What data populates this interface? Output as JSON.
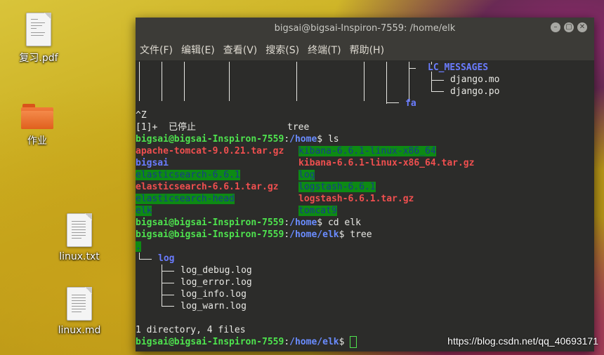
{
  "desktop": {
    "icons": [
      {
        "label": "复习.pdf",
        "icon": "pdf-file-icon"
      },
      {
        "label": "作业",
        "icon": "folder-icon"
      },
      {
        "label": "linux.txt",
        "icon": "text-file-icon"
      },
      {
        "label": "linux.md",
        "icon": "text-file-icon"
      }
    ]
  },
  "window": {
    "title": "bigsai@bigsai-Inspiron-7559: /home/elk",
    "menu": [
      "文件(F)",
      "编辑(E)",
      "查看(V)",
      "搜索(S)",
      "终端(T)",
      "帮助(H)"
    ]
  },
  "terminal": {
    "tree_top": {
      "lc": "LC_MESSAGES",
      "mo": "django.mo",
      "po": "django.po",
      "fa": "fa"
    },
    "ctrlz": "^Z",
    "job": {
      "num": "[1]+",
      "state": "已停止",
      "cmd": "tree"
    },
    "prompt_user": "bigsai@bigsai-Inspiron-7559",
    "ls": {
      "path": "/home",
      "cmd": "$ ls",
      "left": [
        "apache-tomcat-9.0.21.tar.gz",
        "bigsai",
        "elasticsearch-6.6.1",
        "elasticsearch-6.6.1.tar.gz",
        "elasticsearch-head",
        "elk"
      ],
      "right": [
        "kibana-6.6.1-linux-x86_64",
        "kibana-6.6.1-linux-x86_64.tar.gz",
        "log",
        "logstash-6.6.1",
        "logstash-6.6.1.tar.gz",
        "tomcat9"
      ]
    },
    "cd": {
      "path": "/home",
      "cmd": "$ cd elk"
    },
    "tree": {
      "path": "/home/elk",
      "cmd": "$ tree",
      "root": ".",
      "dir": "log",
      "files": [
        "log_debug.log",
        "log_error.log",
        "log_info.log",
        "log_warn.log"
      ],
      "summary": "1 directory, 4 files"
    },
    "final": {
      "path": "/home/elk",
      "cmd": "$ "
    }
  },
  "watermark": "https://blog.csdn.net/qq_40693171"
}
